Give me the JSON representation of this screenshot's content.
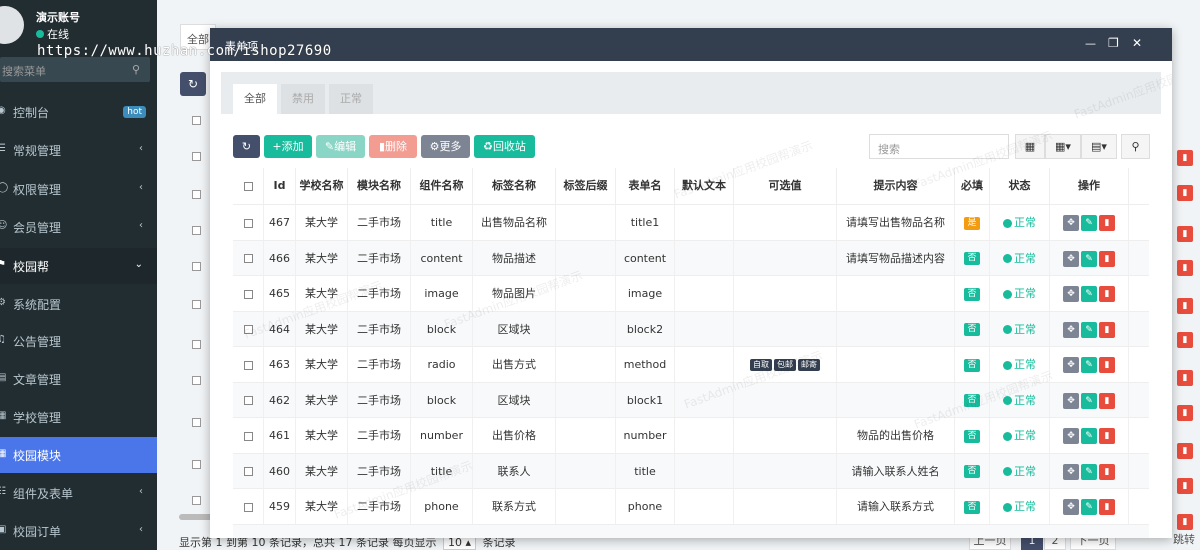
{
  "sidebar": {
    "user_name": "演示账号",
    "user_status": "在线",
    "search_placeholder": "搜索菜单",
    "items": [
      {
        "label": "控制台",
        "badge": "hot"
      },
      {
        "label": "常规管理"
      },
      {
        "label": "权限管理"
      },
      {
        "label": "会员管理"
      },
      {
        "label": "校园帮"
      },
      {
        "label": "系统配置"
      },
      {
        "label": "公告管理"
      },
      {
        "label": "文章管理"
      },
      {
        "label": "学校管理"
      },
      {
        "label": "校园模块"
      },
      {
        "label": "组件及表单"
      },
      {
        "label": "校园订单"
      }
    ]
  },
  "overlay_url": "https://www.huzhan.com/ishop27690",
  "background": {
    "tab_label": "全部",
    "footer_prefix": "显示第 1 到第 10 条记录，总共 17 条记录 每页显示",
    "page_size": "10",
    "footer_suffix": "条记录",
    "pager": {
      "prev": "上一页",
      "p1": "1",
      "p2": "2",
      "next": "下一页",
      "jump": "跳转"
    }
  },
  "modal": {
    "title": "表单项",
    "tabs": [
      "全部",
      "禁用",
      "正常"
    ],
    "toolbar": {
      "add": "添加",
      "edit": "编辑",
      "delete": "删除",
      "more": "更多",
      "recycle": "回收站",
      "search_placeholder": "搜索"
    },
    "columns": [
      "Id",
      "学校名称",
      "模块名称",
      "组件名称",
      "标签名称",
      "标签后缀",
      "表单名",
      "默认文本",
      "可选值",
      "提示内容",
      "必填",
      "状态",
      "操作"
    ],
    "rows": [
      {
        "id": "467",
        "school": "某大学",
        "module": "二手市场",
        "component": "title",
        "label": "出售物品名称",
        "suffix": "",
        "form": "title1",
        "default": "",
        "options": [],
        "hint": "请填写出售物品名称",
        "required": "是",
        "status": "正常"
      },
      {
        "id": "466",
        "school": "某大学",
        "module": "二手市场",
        "component": "content",
        "label": "物品描述",
        "suffix": "",
        "form": "content",
        "default": "",
        "options": [],
        "hint": "请填写物品描述内容",
        "required": "否",
        "status": "正常"
      },
      {
        "id": "465",
        "school": "某大学",
        "module": "二手市场",
        "component": "image",
        "label": "物品图片",
        "suffix": "",
        "form": "image",
        "default": "",
        "options": [],
        "hint": "",
        "required": "否",
        "status": "正常"
      },
      {
        "id": "464",
        "school": "某大学",
        "module": "二手市场",
        "component": "block",
        "label": "区域块",
        "suffix": "",
        "form": "block2",
        "default": "",
        "options": [],
        "hint": "",
        "required": "否",
        "status": "正常"
      },
      {
        "id": "463",
        "school": "某大学",
        "module": "二手市场",
        "component": "radio",
        "label": "出售方式",
        "suffix": "",
        "form": "method",
        "default": "",
        "options": [
          "自取",
          "包邮",
          "邮寄"
        ],
        "hint": "",
        "required": "否",
        "status": "正常"
      },
      {
        "id": "462",
        "school": "某大学",
        "module": "二手市场",
        "component": "block",
        "label": "区域块",
        "suffix": "",
        "form": "block1",
        "default": "",
        "options": [],
        "hint": "",
        "required": "否",
        "status": "正常"
      },
      {
        "id": "461",
        "school": "某大学",
        "module": "二手市场",
        "component": "number",
        "label": "出售价格",
        "suffix": "",
        "form": "number",
        "default": "",
        "options": [],
        "hint": "物品的出售价格",
        "required": "否",
        "status": "正常"
      },
      {
        "id": "460",
        "school": "某大学",
        "module": "二手市场",
        "component": "title",
        "label": "联系人",
        "suffix": "",
        "form": "title",
        "default": "",
        "options": [],
        "hint": "请输入联系人姓名",
        "required": "否",
        "status": "正常"
      },
      {
        "id": "459",
        "school": "某大学",
        "module": "二手市场",
        "component": "phone",
        "label": "联系方式",
        "suffix": "",
        "form": "phone",
        "default": "",
        "options": [],
        "hint": "请输入联系方式",
        "required": "否",
        "status": "正常"
      }
    ],
    "watermark": "FastAdmin应用校园帮演示"
  },
  "colors": {
    "sidebar_bg": "#222d32",
    "active": "#4a76e9",
    "header": "#333e4e",
    "green": "#18bc9c",
    "red": "#e74c3c",
    "orange": "#f39c12"
  }
}
